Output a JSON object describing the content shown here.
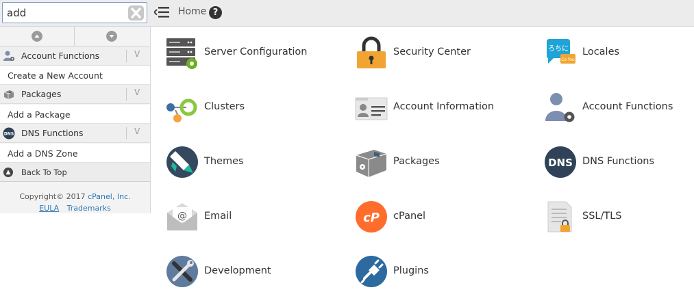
{
  "search": {
    "value": "add"
  },
  "breadcrumb": {
    "home": "Home",
    "help": "?"
  },
  "sidebar": {
    "sections": [
      {
        "header": "Account Functions",
        "item": "Create a New Account"
      },
      {
        "header": "Packages",
        "item": "Add a Package"
      },
      {
        "header": "DNS Functions",
        "item": "Add a DNS Zone"
      }
    ],
    "back_to_top": "Back To Top",
    "copyright_prefix": "Copyright© 2017 ",
    "copyright_link": "cPanel, Inc.",
    "eula": "EULA",
    "trademarks": "Trademarks",
    "chevron": "V"
  },
  "tiles": [
    {
      "label": "Server Configuration",
      "icon": "server-configuration-icon"
    },
    {
      "label": "Security Center",
      "icon": "padlock-icon"
    },
    {
      "label": "Locales",
      "icon": "locales-speech-bubble-icon"
    },
    {
      "label": "Clusters",
      "icon": "clusters-icon"
    },
    {
      "label": "Account Information",
      "icon": "account-information-card-icon"
    },
    {
      "label": "Account Functions",
      "icon": "account-functions-user-gear-icon"
    },
    {
      "label": "Themes",
      "icon": "themes-paint-icon"
    },
    {
      "label": "Packages",
      "icon": "packages-box-icon"
    },
    {
      "label": "DNS Functions",
      "icon": "dns-icon"
    },
    {
      "label": "Email",
      "icon": "email-envelope-icon"
    },
    {
      "label": "cPanel",
      "icon": "cpanel-logo-icon"
    },
    {
      "label": "SSL/TLS",
      "icon": "ssl-tls-certificate-icon"
    },
    {
      "label": "Development",
      "icon": "development-wrench-icon"
    },
    {
      "label": "Plugins",
      "icon": "plugins-plug-icon"
    }
  ],
  "locales_icon_text": "ろちに",
  "locales_icon_subtext": "Ce fou",
  "dns_icon_text": "DNS",
  "colors": {
    "accent_orange": "#f0a532",
    "cpanel_orange": "#ff6c2c",
    "dark_slate": "#34495e",
    "link_blue": "#2a7ab8",
    "gear_green": "#6ab023",
    "cluster_blue": "#3b6ea5",
    "cluster_orange": "#f4a340",
    "cluster_green": "#8dc63f"
  }
}
